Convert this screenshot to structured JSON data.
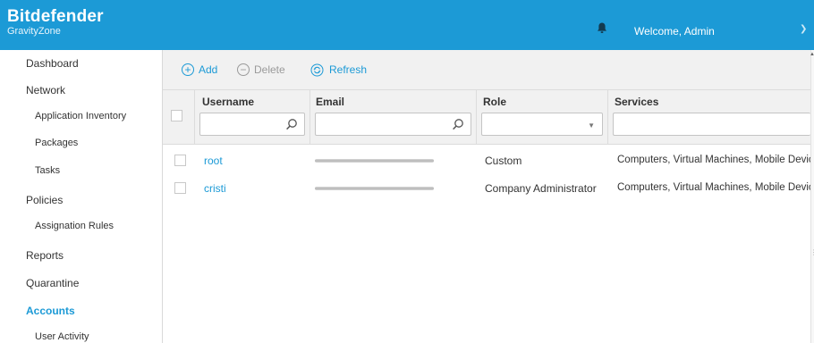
{
  "header": {
    "brand_name": "Bitdefender",
    "brand_sub": "GravityZone",
    "welcome": "Welcome, Admin",
    "bell_icon": "bell-icon",
    "chevron_icon": "chevron-down-icon",
    "bg_color": "#1c9ad6"
  },
  "sidebar": {
    "items": [
      {
        "label": "Dashboard"
      },
      {
        "label": "Network"
      },
      {
        "label": "Application Inventory"
      },
      {
        "label": "Packages"
      },
      {
        "label": "Tasks"
      },
      {
        "label": "Policies"
      },
      {
        "label": "Assignation Rules"
      },
      {
        "label": "Reports"
      },
      {
        "label": "Quarantine"
      },
      {
        "label": "Accounts"
      },
      {
        "label": "User Activity"
      }
    ],
    "active": "Accounts"
  },
  "toolbar": {
    "add": "Add",
    "delete": "Delete",
    "refresh": "Refresh"
  },
  "table": {
    "columns": [
      "Username",
      "Email",
      "Role",
      "Services"
    ],
    "filters": {
      "username_placeholder": "",
      "email_placeholder": "",
      "role_value": "",
      "services_placeholder": ""
    },
    "rows": [
      {
        "username": "root",
        "email": "",
        "role": "Custom",
        "services": "Computers, Virtual Machines, Mobile Devices"
      },
      {
        "username": "cristi",
        "email": "",
        "role": "Company Administrator",
        "services": "Computers, Virtual Machines, Mobile Devices"
      }
    ]
  },
  "colors": {
    "accent": "#1c9ad6",
    "toolbar_bg": "#f1f1f1",
    "disabled": "#9a9a9a"
  }
}
